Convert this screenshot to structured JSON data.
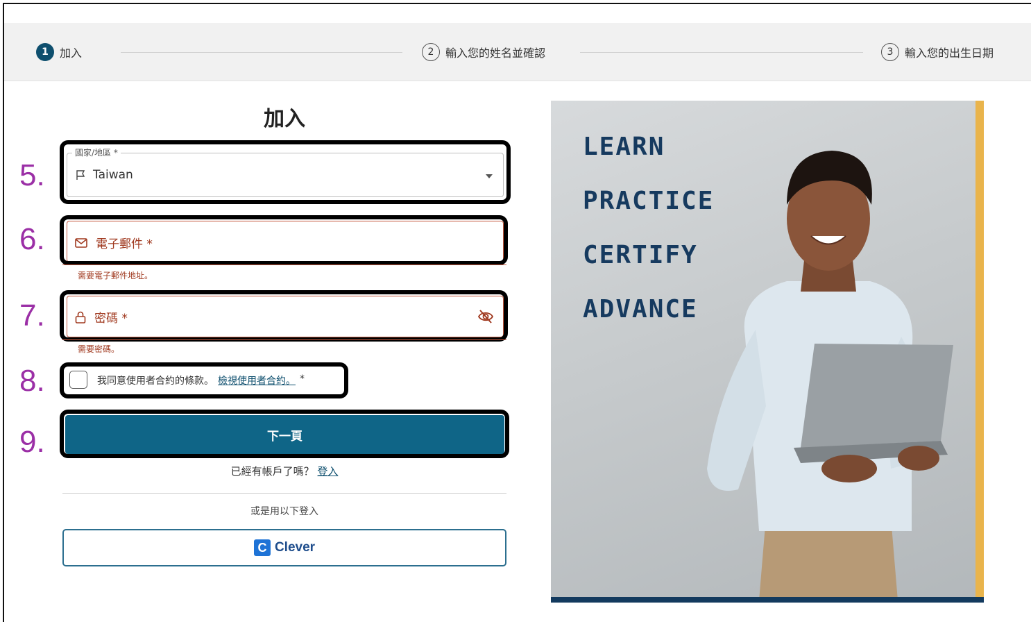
{
  "stepper": {
    "steps": [
      {
        "num": "1",
        "label": "加入"
      },
      {
        "num": "2",
        "label": "輸入您的姓名並確認"
      },
      {
        "num": "3",
        "label": "輸入您的出生日期"
      }
    ]
  },
  "form": {
    "title": "加入",
    "country": {
      "legend": "國家/地區 *",
      "value": "Taiwan"
    },
    "email": {
      "label": "電子郵件 *",
      "error": "需要電子郵件地址。"
    },
    "password": {
      "label": "密碼 *",
      "error": "需要密碼。"
    },
    "terms": {
      "text": "我同意使用者合約的條款。",
      "link": "檢視使用者合約。",
      "required": "*"
    },
    "next_label": "下一頁",
    "have_account": "已經有帳戶了嗎？",
    "login_link": "登入",
    "or_login": "或是用以下登入",
    "clever": {
      "logo": "C",
      "label": "Clever"
    }
  },
  "annotations": [
    "5.",
    "6.",
    "7.",
    "8.",
    "9."
  ],
  "promo": {
    "words": [
      "LEARN",
      "PRACTICE",
      "CERTIFY",
      "ADVANCE"
    ]
  },
  "colors": {
    "primary": "#0f6587",
    "step_active": "#0e4f6e",
    "error": "#a0391f",
    "annotation": "#9b2fa6",
    "promo_text": "#163a5f",
    "promo_accent": "#e9b44c"
  }
}
